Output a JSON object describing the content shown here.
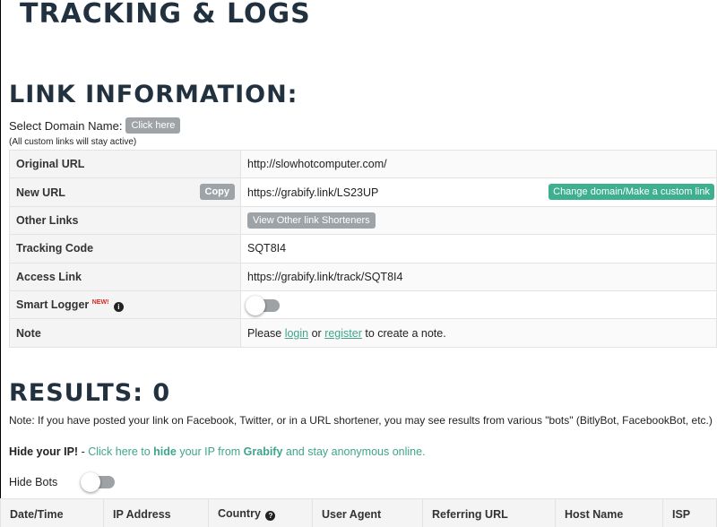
{
  "header": {
    "title": "TRACKING & LOGS"
  },
  "link_info": {
    "title": "LINK INFORMATION:",
    "select_domain_label": "Select Domain Name:",
    "click_here_button": "Click here",
    "custom_links_note": "(All custom links will stay active)",
    "rows": {
      "original_url": {
        "label": "Original URL",
        "value": "http://slowhotcomputer.com/"
      },
      "new_url": {
        "label": "New URL",
        "value": "https://grabify.link/LS23UP",
        "copy_button": "Copy",
        "change_button": "Change domain/Make a custom link"
      },
      "other_links": {
        "label": "Other Links",
        "button": "View Other link Shorteners"
      },
      "tracking_code": {
        "label": "Tracking Code",
        "value": "SQT8I4"
      },
      "access_link": {
        "label": "Access Link",
        "value": "https://grabify.link/track/SQT8I4"
      },
      "smart_logger": {
        "label": "Smart Logger",
        "badge": "NEW!",
        "toggle_on": false
      },
      "note": {
        "label": "Note",
        "prefix": "Please ",
        "login": "login",
        "or": " or ",
        "register": "register",
        "suffix": " to create a note."
      }
    }
  },
  "results": {
    "title": "RESULTS: 0",
    "note": "Note: If you have posted your link on Facebook, Twitter, or in a URL shortener, you may see results from various \"bots\" (BitlyBot, FacebookBot, etc.)",
    "hide_ip": {
      "label": "Hide your IP!",
      "sep": " - ",
      "text_a": "Click here to ",
      "text_b": "hide",
      "text_c": " your IP from ",
      "text_d": "Grabify",
      "text_e": " and stay anonymous online."
    },
    "hide_bots": {
      "label": "Hide Bots",
      "toggle_on": false
    },
    "columns": [
      "Date/Time",
      "IP Address",
      "Country",
      "User Agent",
      "Referring URL",
      "Host Name",
      "ISP"
    ]
  },
  "colors": {
    "accent_green": "#3fb08f",
    "heading": "#22313f",
    "button_gray": "#9da3a6",
    "badge_red": "#d9261c"
  }
}
